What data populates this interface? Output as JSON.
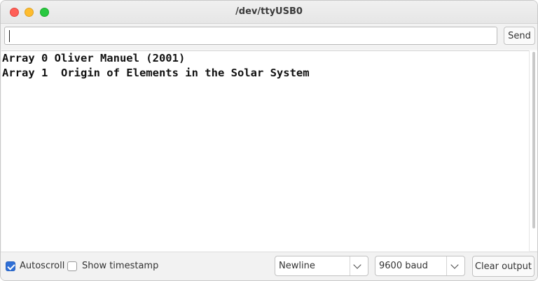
{
  "window": {
    "title": "/dev/ttyUSB0"
  },
  "input": {
    "value": "",
    "send_label": "Send"
  },
  "output": {
    "lines": [
      "Array 0 Oliver Manuel (2001)",
      "Array 1  Origin of Elements in the Solar System"
    ]
  },
  "footer": {
    "autoscroll_label": "Autoscroll",
    "autoscroll_checked": true,
    "timestamp_label": "Show timestamp",
    "timestamp_checked": false,
    "line_ending": "Newline",
    "baud_rate": "9600 baud",
    "clear_label": "Clear output"
  },
  "colors": {
    "checkbox_accent": "#2f6fd6",
    "close": "#ff5f57",
    "minimize": "#febc2e",
    "maximize": "#28c840"
  }
}
